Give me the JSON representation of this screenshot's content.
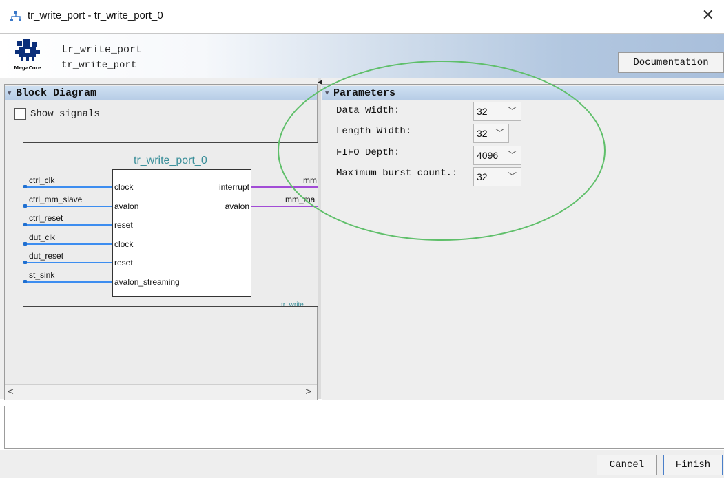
{
  "window": {
    "title": "tr_write_port - tr_write_port_0",
    "close_glyph": "✕"
  },
  "header": {
    "name": "tr_write_port",
    "subname": "tr_write_port",
    "logo_text": "MegaCore",
    "logo_icon": "megacore-logo-icon",
    "documentation_label": "Documentation"
  },
  "block_diagram": {
    "title": "Block Diagram",
    "show_signals_label": "Show signals",
    "show_signals_checked": false,
    "component_title": "tr_write_port_0",
    "export_label": "tr_write_",
    "left_signals": [
      {
        "name": "ctrl_clk",
        "port": "clock"
      },
      {
        "name": "ctrl_mm_slave",
        "port": "avalon"
      },
      {
        "name": "ctrl_reset",
        "port": "reset"
      },
      {
        "name": "dut_clk",
        "port": "clock"
      },
      {
        "name": "dut_reset",
        "port": "reset"
      },
      {
        "name": "st_sink",
        "port": "avalon_streaming"
      }
    ],
    "right_ports": [
      {
        "port": "interrupt",
        "signal": "mm"
      },
      {
        "port": "avalon",
        "signal": "mm_ma"
      }
    ],
    "scroll_left": "<",
    "scroll_right": ">"
  },
  "parameters": {
    "title": "Parameters",
    "items": [
      {
        "label": "Data Width:",
        "value": "32"
      },
      {
        "label": "Length Width:",
        "value": "32"
      },
      {
        "label": "FIFO Depth:",
        "value": "4096"
      },
      {
        "label": "Maximum burst count.:",
        "value": "32"
      }
    ]
  },
  "buttons": {
    "cancel": "Cancel",
    "finish": "Finish"
  },
  "colors": {
    "accent_line": "#3c8df0",
    "output_line": "#a24cd6",
    "annotation": "#5fbf6a",
    "component_title": "#3b8f9a"
  }
}
